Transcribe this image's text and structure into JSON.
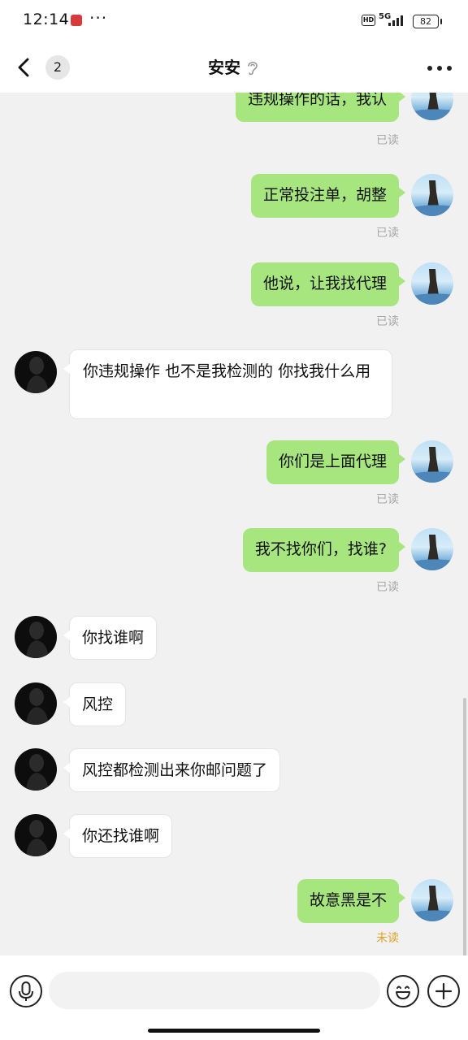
{
  "status_bar": {
    "time": "12:14",
    "network": "5G",
    "hd_label": "HD",
    "battery": "82",
    "app_notification_color": "#d83b3b"
  },
  "header": {
    "unread_count": "2",
    "title": "安安",
    "icons": [
      "back-chevron-icon",
      "ear-icon",
      "more-icon"
    ]
  },
  "messages": [
    {
      "side": "self",
      "text": "违规操作的话，我认",
      "status": "已读"
    },
    {
      "side": "self",
      "text": "正常投注单，胡整",
      "status": "已读"
    },
    {
      "side": "self",
      "text": "他说，让我找代理",
      "status": "已读"
    },
    {
      "side": "other",
      "text": "你违规操作 也不是我检测的 你找我什么用"
    },
    {
      "side": "self",
      "text": "你们是上面代理",
      "status": "已读"
    },
    {
      "side": "self",
      "text": "我不找你们，找谁?",
      "status": "已读"
    },
    {
      "side": "other",
      "text": "你找谁啊"
    },
    {
      "side": "other",
      "text": "风控"
    },
    {
      "side": "other",
      "text": "风控都检测出来你邮问题了"
    },
    {
      "side": "other",
      "text": "你还找谁啊"
    },
    {
      "side": "self",
      "text": "故意黑是不",
      "status": "未读"
    }
  ],
  "input_bar": {
    "placeholder": "",
    "icons": [
      "microphone-icon",
      "emoji-icon",
      "plus-icon"
    ]
  },
  "colors": {
    "self_bubble": "#a7e57f",
    "other_bubble": "#ffffff",
    "background": "#f1f1f1",
    "unread_status": "#e0a226",
    "read_status": "#a6a6a6"
  }
}
